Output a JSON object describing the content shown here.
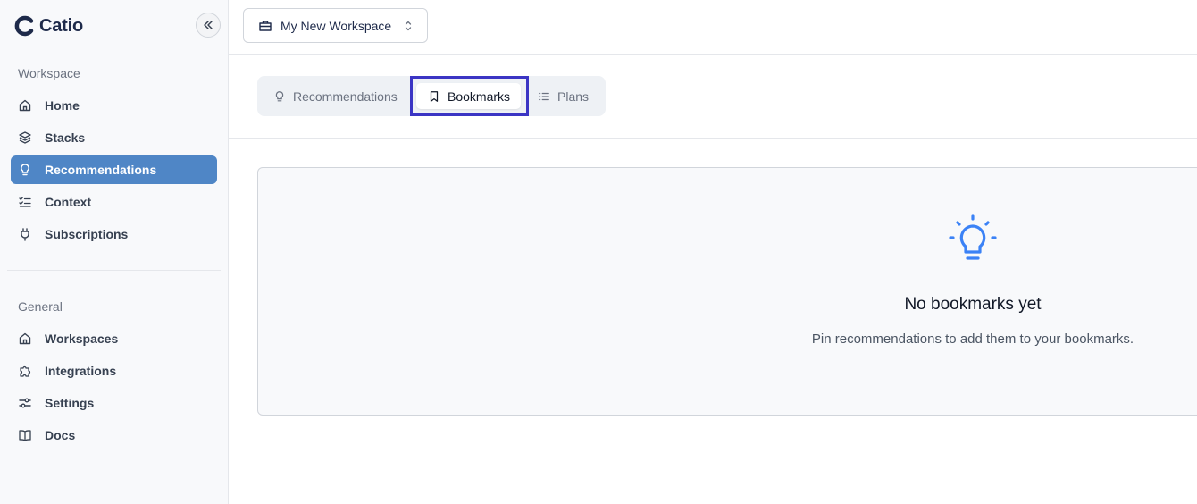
{
  "app": {
    "name": "Catio"
  },
  "sidebar": {
    "workspace_label": "Workspace",
    "workspace_items": [
      {
        "label": "Home",
        "icon": "home-icon"
      },
      {
        "label": "Stacks",
        "icon": "layers-icon"
      },
      {
        "label": "Recommendations",
        "icon": "lightbulb-icon",
        "active": true
      },
      {
        "label": "Context",
        "icon": "checklist-icon"
      },
      {
        "label": "Subscriptions",
        "icon": "plug-icon"
      }
    ],
    "general_label": "General",
    "general_items": [
      {
        "label": "Workspaces",
        "icon": "home-icon"
      },
      {
        "label": "Integrations",
        "icon": "puzzle-icon"
      },
      {
        "label": "Settings",
        "icon": "sliders-icon"
      },
      {
        "label": "Docs",
        "icon": "book-icon"
      }
    ]
  },
  "topbar": {
    "workspace_name": "My New Workspace"
  },
  "tabs": [
    {
      "label": "Recommendations",
      "icon": "lightbulb-icon"
    },
    {
      "label": "Bookmarks",
      "icon": "bookmark-icon",
      "active": true
    },
    {
      "label": "Plans",
      "icon": "list-icon"
    }
  ],
  "empty_state": {
    "title": "No bookmarks yet",
    "description": "Pin recommendations to add them to your bookmarks."
  },
  "colors": {
    "accent": "#4f86c6",
    "highlight": "#3b35c4",
    "icon_blue": "#3b82f6"
  }
}
